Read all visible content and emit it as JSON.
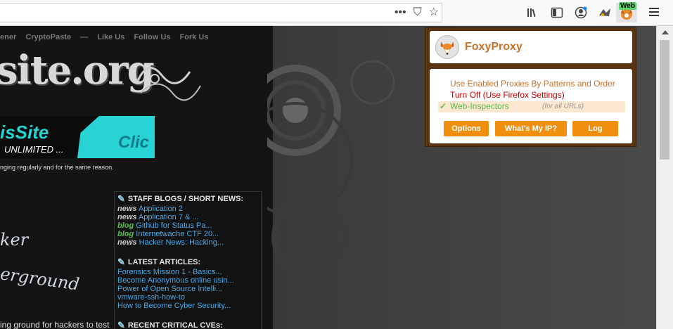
{
  "browser": {
    "url_actions": [
      "•••",
      "⛉",
      "☆"
    ],
    "extension_badge": "Web",
    "icons": [
      "library-icon",
      "reader-sidebar-icon",
      "account-icon",
      "tracking-icon",
      "foxyproxy-icon",
      "menu-icon"
    ]
  },
  "page": {
    "topnav": [
      "ener",
      "CryptoPaste",
      "—",
      "Like Us",
      "Follow Us",
      "Fork Us"
    ],
    "logo_text": "site.org",
    "banner": {
      "title": "isSite",
      "subtitle": "UNLIMITED ...",
      "click": "Clic"
    },
    "tagline": "nging regularly and for the same reason.",
    "handwriting1": "ker",
    "handwriting2": "erground",
    "bottom_text": "ing ground for hackers to test",
    "news": {
      "staff_heading": "STAFF BLOGS / SHORT NEWS:",
      "staff_items": [
        {
          "tag": "news",
          "text": "Application 2"
        },
        {
          "tag": "news",
          "text": "Application 7 & ..."
        },
        {
          "tag": "blog",
          "text": "Github for Status Pa..."
        },
        {
          "tag": "blog",
          "text": "Internetwache CTF 20..."
        },
        {
          "tag": "news",
          "text": "Hacker News: Hacking..."
        }
      ],
      "articles_heading": "LATEST ARTICLES:",
      "articles": [
        "Forensics Mission 1 - Basics...",
        "Become Anonymous online usin...",
        "Power of Open Source Intelli...",
        "vmware-ssh-how-to",
        "How to Become Cyber Security..."
      ],
      "cve_heading": "RECENT CRITICAL CVEs:"
    }
  },
  "popup": {
    "title": "FoxyProxy",
    "option1": "Use Enabled Proxies By Patterns and Order",
    "option2": "Turn Off (Use Firefox Settings)",
    "option3_check": "✓",
    "option3_name": "Web-Inspectors",
    "option3_scope": "(for all URLs)",
    "btn_options": "Options",
    "btn_ip": "What's My IP?",
    "btn_log": "Log"
  }
}
